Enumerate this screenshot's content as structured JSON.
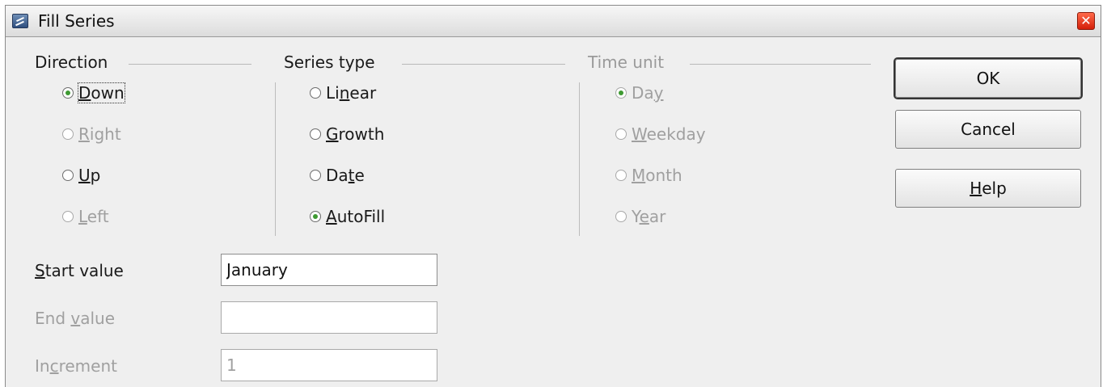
{
  "window": {
    "title": "Fill Series",
    "close_glyph": "✕"
  },
  "direction": {
    "title": "Direction",
    "options": [
      {
        "pre": "",
        "key": "D",
        "post": "own",
        "checked": true,
        "disabled": false
      },
      {
        "pre": "",
        "key": "R",
        "post": "ight",
        "checked": false,
        "disabled": true
      },
      {
        "pre": "",
        "key": "U",
        "post": "p",
        "checked": false,
        "disabled": false
      },
      {
        "pre": "",
        "key": "L",
        "post": "eft",
        "checked": false,
        "disabled": true
      }
    ]
  },
  "series_type": {
    "title": "Series type",
    "options": [
      {
        "pre": "Li",
        "key": "n",
        "post": "ear",
        "checked": false,
        "disabled": false
      },
      {
        "pre": "",
        "key": "G",
        "post": "rowth",
        "checked": false,
        "disabled": false
      },
      {
        "pre": "Da",
        "key": "t",
        "post": "e",
        "checked": false,
        "disabled": false
      },
      {
        "pre": "",
        "key": "A",
        "post": "utoFill",
        "checked": true,
        "disabled": false
      }
    ]
  },
  "time_unit": {
    "title": "Time unit",
    "options": [
      {
        "pre": "Da",
        "key": "y",
        "post": "",
        "checked": true,
        "disabled": true
      },
      {
        "pre": "",
        "key": "W",
        "post": "eekday",
        "checked": false,
        "disabled": true
      },
      {
        "pre": "",
        "key": "M",
        "post": "onth",
        "checked": false,
        "disabled": true
      },
      {
        "pre": "Y",
        "key": "e",
        "post": "ar",
        "checked": false,
        "disabled": true
      }
    ]
  },
  "buttons": {
    "ok": "OK",
    "cancel": "Cancel",
    "help_key": "H",
    "help_rest": "elp"
  },
  "fields": {
    "start": {
      "pre": "",
      "key": "S",
      "post": "tart value",
      "value": "January"
    },
    "end": {
      "pre": "End ",
      "key": "v",
      "post": "alue",
      "value": ""
    },
    "increment": {
      "pre": "In",
      "key": "c",
      "post": "rement",
      "value": "1"
    }
  },
  "colors": {
    "radio_checked": "#3e9a32",
    "close_button": "#d4200a"
  }
}
